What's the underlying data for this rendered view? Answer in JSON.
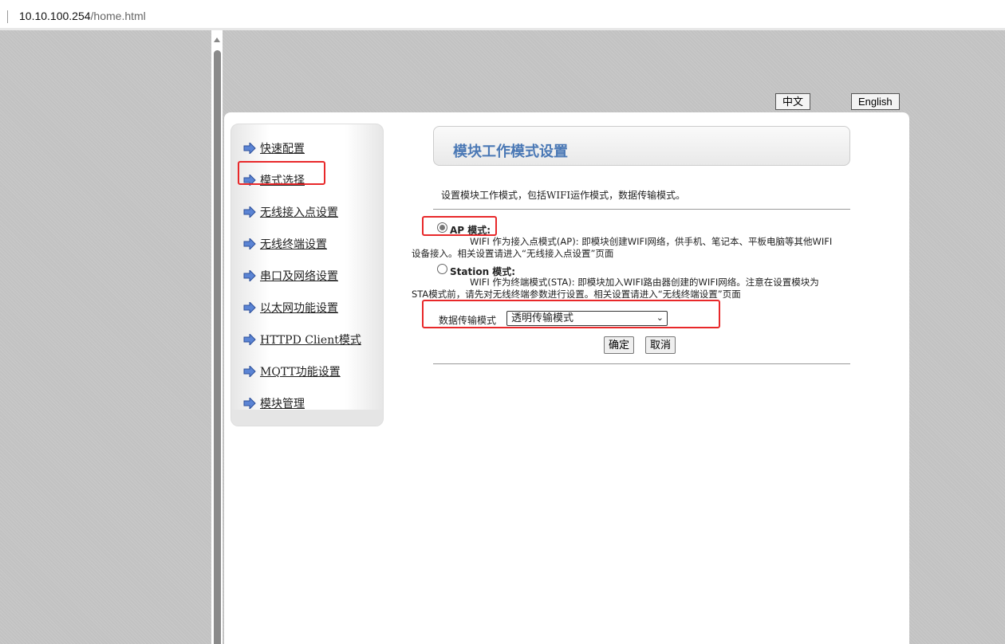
{
  "browser": {
    "url_host": "10.10.100.254",
    "url_path": "/home.html"
  },
  "lang": {
    "zh": "中文",
    "en": "English"
  },
  "sidebar": {
    "items": [
      {
        "label": "快速配置"
      },
      {
        "label": "模式选择"
      },
      {
        "label": "无线接入点设置"
      },
      {
        "label": "无线终端设置"
      },
      {
        "label": "串口及网络设置"
      },
      {
        "label": "以太网功能设置"
      },
      {
        "label": "HTTPD Client模式"
      },
      {
        "label": "MQTT功能设置"
      },
      {
        "label": "模块管理"
      }
    ]
  },
  "main": {
    "title": "模块工作模式设置",
    "description": "设置模块工作模式，包括WIFI运作模式，数据传输模式。",
    "ap_label": "AP 模式:",
    "ap_desc": "WIFI 作为接入点模式(AP): 即模块创建WIFI网络，供手机、笔记本、平板电脑等其他WIFI设备接入。相关设置请进入“无线接入点设置”页面",
    "sta_label": "Station 模式:",
    "sta_desc": "WIFI 作为终端模式(STA): 即模块加入WIFI路由器创建的WIFI网络。注意在设置模块为STA模式前，请先对无线终端参数进行设置。相关设置请进入“无线终端设置”页面",
    "transfer_label": "数据传输模式",
    "transfer_value": "透明传输模式",
    "ok": "确定",
    "cancel": "取消",
    "selected_mode": "AP"
  },
  "colors": {
    "highlight": "#e8282a",
    "title": "#4a78b5"
  }
}
